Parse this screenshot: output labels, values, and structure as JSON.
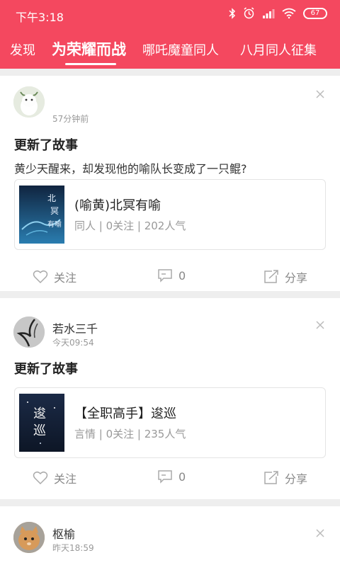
{
  "status_bar": {
    "time": "下午3:18",
    "battery": "67"
  },
  "tabs": [
    {
      "label": "发现"
    },
    {
      "label": "为荣耀而战"
    },
    {
      "label": "哪吒魔童同人"
    },
    {
      "label": "八月同人征集"
    }
  ],
  "posts": [
    {
      "author": "",
      "time": "57分钟前",
      "title": "更新了故事",
      "description": "黄少天醒来，却发现他的喻队长变成了一只鲲?",
      "story": {
        "title": "(喻黄)北冥有喻",
        "meta": "同人 | 0关注 | 202人气"
      },
      "actions": {
        "follow": "关注",
        "comments": "0",
        "share": "分享"
      }
    },
    {
      "author": "若水三千",
      "time": "今天09:54",
      "title": "更新了故事",
      "story": {
        "title": "【全职高手】逡巡",
        "meta": "言情 | 0关注 | 235人气"
      },
      "actions": {
        "follow": "关注",
        "comments": "0",
        "share": "分享"
      }
    },
    {
      "author": "枢榆",
      "time": "昨天18:59"
    }
  ],
  "colors": {
    "brand": "#f4485f",
    "divider": "#eeeeee",
    "muted": "#999999"
  }
}
